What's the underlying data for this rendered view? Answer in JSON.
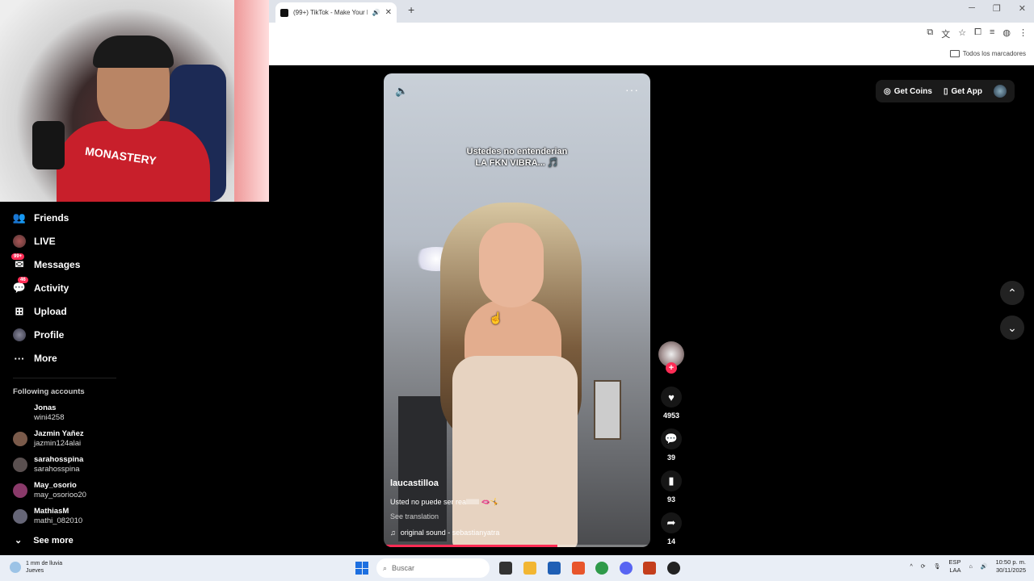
{
  "browser": {
    "tab_title": "(99+) TikTok - Make Your D...",
    "tab_sound": "🔊",
    "new_tab": "+",
    "bookmarks_all": "Todos los marcadores"
  },
  "webcam": {
    "shirt_text": "MONASTERY"
  },
  "nav": {
    "items": [
      {
        "label": "Friends",
        "icon": "friends-icon"
      },
      {
        "label": "LIVE",
        "icon": "live-icon"
      },
      {
        "label": "Messages",
        "icon": "messages-icon",
        "badge": "99+"
      },
      {
        "label": "Activity",
        "icon": "activity-icon",
        "badge": "46"
      },
      {
        "label": "Upload",
        "icon": "upload-icon"
      },
      {
        "label": "Profile",
        "icon": "profile-icon"
      },
      {
        "label": "More",
        "icon": "more-icon"
      }
    ],
    "following_title": "Following accounts",
    "accounts": [
      {
        "name": "Jonas",
        "handle": "wini4258"
      },
      {
        "name": "Jazmin Yañez",
        "handle": "jazmin124alai"
      },
      {
        "name": "sarahosspina",
        "handle": "sarahosspina"
      },
      {
        "name": "May_osorio",
        "handle": "may_osorioo20"
      },
      {
        "name": "MathiasM",
        "handle": "mathi_082010"
      }
    ],
    "see_more": "See more"
  },
  "video": {
    "caption_line1": "Ustedes no entenderian",
    "caption_line2": "LA FKN VIBRA... 🎵",
    "username": "laucastilloa",
    "description": "Usted no puede ser reallllllll 🫦🤸",
    "see_translation": "See translation",
    "sound": "original sound - sebastianyatra",
    "progress_fraction": 0.65
  },
  "actions": {
    "likes": "4953",
    "comments": "39",
    "saves": "93",
    "shares": "14"
  },
  "header": {
    "get_coins": "Get Coins",
    "get_app": "Get App"
  },
  "taskbar": {
    "weather_line1": "1 mm de lluvia",
    "weather_line2": "Jueves",
    "search_placeholder": "Buscar",
    "lang_line1": "ESP",
    "lang_line2": "LAA",
    "time": "10:50 p. m.",
    "date": "30/11/2025"
  },
  "colors": {
    "accent": "#fe2c55",
    "background": "#000000"
  }
}
